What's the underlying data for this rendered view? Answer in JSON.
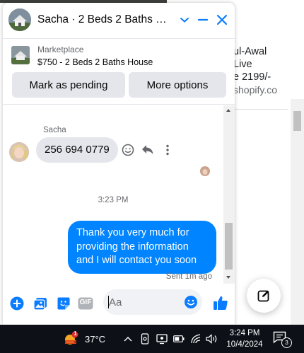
{
  "background": {
    "side_text_lines": [
      "ul-Awal",
      "Live",
      "e 2199/-",
      "shopify.co"
    ]
  },
  "chat": {
    "header": {
      "title": "Sacha · 2 Beds 2 Baths Ho…",
      "actions": [
        "chevron-down-icon",
        "minimize-icon",
        "close-icon"
      ]
    },
    "listing": {
      "type": "Marketplace",
      "title": "$750 - 2 Beds 2 Baths House",
      "mark_pending_label": "Mark as pending",
      "more_options_label": "More options"
    },
    "messages": {
      "sender_name": "Sacha",
      "incoming_text": "256 694 0779",
      "timestamp": "3:23 PM",
      "outgoing_text": "Thank you very much for providing the information and I will contact you soon",
      "sent_label": "Sent 1m ago"
    },
    "composer": {
      "placeholder": "Aa",
      "gif_label": "GIF"
    }
  },
  "taskbar": {
    "weather_badge": "1",
    "temperature": "37°C",
    "time": "3:24 PM",
    "date": "10/4/2024",
    "notification_count": "3"
  },
  "colors": {
    "messenger_blue": "#0084ff",
    "bubble_grey": "#e4e6eb",
    "icon_blue": "#0a7cff",
    "taskbar": "#0d1117"
  }
}
